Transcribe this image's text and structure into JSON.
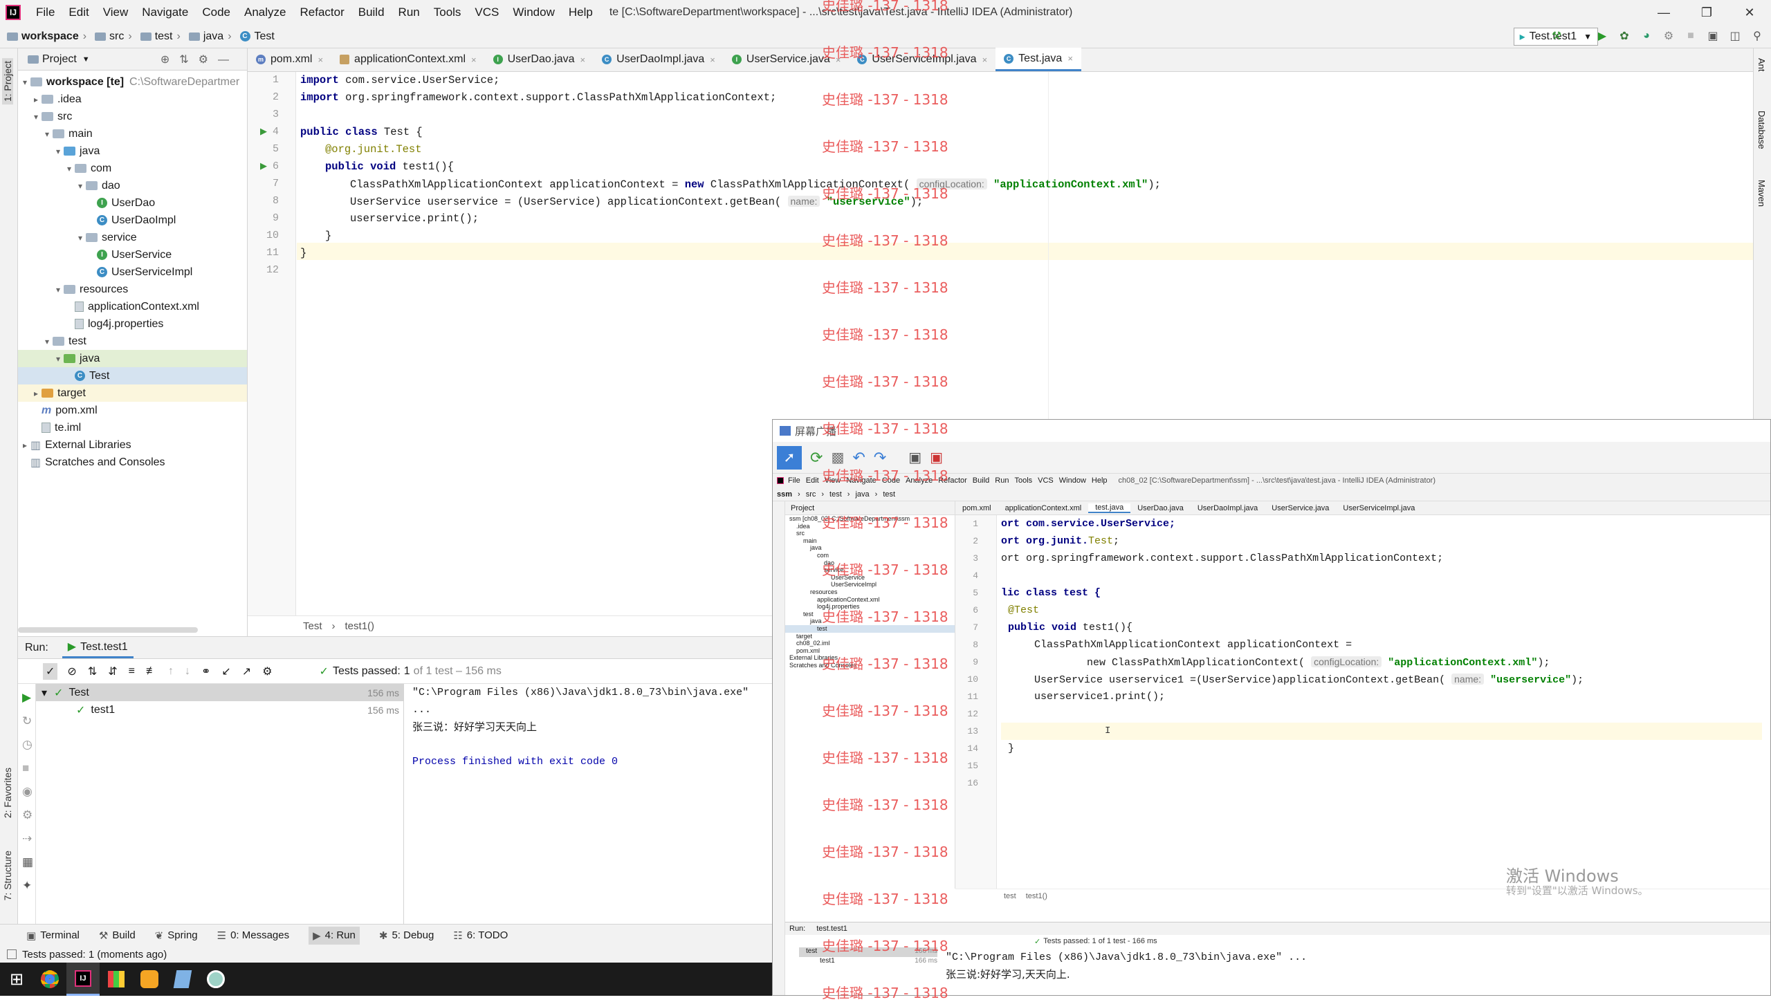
{
  "titlebar": {
    "menu": [
      "File",
      "Edit",
      "View",
      "Navigate",
      "Code",
      "Analyze",
      "Refactor",
      "Build",
      "Run",
      "Tools",
      "VCS",
      "Window",
      "Help"
    ],
    "title": "te [C:\\SoftwareDepartment\\workspace] - ...\\src\\test\\java\\Test.java - IntelliJ IDEA (Administrator)"
  },
  "nav": {
    "crumbs": [
      "workspace",
      "src",
      "test",
      "java",
      "Test"
    ],
    "run_config": "Test.test1"
  },
  "project": {
    "header": "Project",
    "side_label": "1: Project",
    "tree": [
      {
        "label": "workspace [te]",
        "extra": "C:\\SoftwareDepartmer",
        "indent": 0,
        "arrow": "v",
        "type": "folder"
      },
      {
        "label": ".idea",
        "indent": 1,
        "arrow": ">",
        "type": "folder"
      },
      {
        "label": "src",
        "indent": 1,
        "arrow": "v",
        "type": "folder"
      },
      {
        "label": "main",
        "indent": 2,
        "arrow": "v",
        "type": "folder"
      },
      {
        "label": "java",
        "indent": 3,
        "arrow": "v",
        "type": "src"
      },
      {
        "label": "com",
        "indent": 4,
        "arrow": "v",
        "type": "folder"
      },
      {
        "label": "dao",
        "indent": 5,
        "arrow": "v",
        "type": "folder"
      },
      {
        "label": "UserDao",
        "indent": 6,
        "arrow": "",
        "type": "interface"
      },
      {
        "label": "UserDaoImpl",
        "indent": 6,
        "arrow": "",
        "type": "class"
      },
      {
        "label": "service",
        "indent": 5,
        "arrow": "v",
        "type": "folder"
      },
      {
        "label": "UserService",
        "indent": 6,
        "arrow": "",
        "type": "interface"
      },
      {
        "label": "UserServiceImpl",
        "indent": 6,
        "arrow": "",
        "type": "class"
      },
      {
        "label": "resources",
        "indent": 3,
        "arrow": "v",
        "type": "folder"
      },
      {
        "label": "applicationContext.xml",
        "indent": 4,
        "arrow": "",
        "type": "file"
      },
      {
        "label": "log4j.properties",
        "indent": 4,
        "arrow": "",
        "type": "file"
      },
      {
        "label": "test",
        "indent": 2,
        "arrow": "v",
        "type": "folder"
      },
      {
        "label": "java",
        "indent": 3,
        "arrow": "v",
        "type": "test"
      },
      {
        "label": "Test",
        "indent": 4,
        "arrow": "",
        "type": "class"
      },
      {
        "label": "target",
        "indent": 1,
        "arrow": ">",
        "type": "target"
      },
      {
        "label": "pom.xml",
        "indent": 1,
        "arrow": "",
        "type": "maven"
      },
      {
        "label": "te.iml",
        "indent": 1,
        "arrow": "",
        "type": "file"
      },
      {
        "label": "External Libraries",
        "indent": 0,
        "arrow": ">",
        "type": "lib"
      },
      {
        "label": "Scratches and Consoles",
        "indent": 0,
        "arrow": "",
        "type": "lib"
      }
    ]
  },
  "tabs": [
    {
      "label": "pom.xml",
      "type": "maven"
    },
    {
      "label": "applicationContext.xml",
      "type": "file"
    },
    {
      "label": "UserDao.java",
      "type": "interface"
    },
    {
      "label": "UserDaoImpl.java",
      "type": "class"
    },
    {
      "label": "UserService.java",
      "type": "interface"
    },
    {
      "label": "UserServiceImpl.java",
      "type": "class"
    },
    {
      "label": "Test.java",
      "type": "class"
    }
  ],
  "code": {
    "line_numbers": [
      "1",
      "2",
      "3",
      "4",
      "5",
      "6",
      "7",
      "8",
      "9",
      "10",
      "11",
      "12"
    ],
    "l1a": "import ",
    "l1b": "com.service.UserService;",
    "l2a": "import ",
    "l2b": "org.springframework.context.support.ClassPathXmlApplicationContext;",
    "l4a": "public class ",
    "l4b": "Test {",
    "l5a": "@org.junit.",
    "l5b": "Test",
    "l6a": "public void ",
    "l6b": "test1(){",
    "l7a": "ClassPathXmlApplicationContext applicationContext = ",
    "l7b": "new ",
    "l7c": "ClassPathXmlApplicationContext(",
    "l7hint": "configLocation:",
    "l7str": "\"applicationContext.xml\"",
    "l7e": ");",
    "l8a": "UserService userservice = (UserService) applicationContext.getBean(",
    "l8hint": "name:",
    "l8str": "\"userservice\"",
    "l8e": ");",
    "l9": "userservice.print();",
    "l10": "}",
    "l11": "}",
    "footer": [
      "Test",
      "test1()"
    ]
  },
  "run": {
    "label": "Run:",
    "tab": "Test.test1",
    "passed": "Tests passed:",
    "passed_count": "1",
    "passed_rest": "of 1 test – 156 ms",
    "tree": [
      {
        "label": "Test",
        "time": "156 ms"
      },
      {
        "label": "test1",
        "time": "156 ms"
      }
    ],
    "console": [
      "\"C:\\Program Files (x86)\\Java\\jdk1.8.0_73\\bin\\java.exe\" ...",
      "张三说：好好学习天天向上",
      "",
      "Process finished with exit code 0"
    ]
  },
  "side_labels": {
    "favorites": "2: Favorites",
    "structure": "7: Structure",
    "ant": "Ant",
    "database": "Database",
    "maven": "Maven"
  },
  "bottom_tools": [
    {
      "label": "Terminal"
    },
    {
      "label": "Build"
    },
    {
      "label": "Spring"
    },
    {
      "label": "0: Messages"
    },
    {
      "label": "4: Run"
    },
    {
      "label": "5: Debug"
    },
    {
      "label": "6: TODO"
    }
  ],
  "status": "Tests passed: 1 (moments ago)",
  "watermark": "史佳璐 -137 - 1318",
  "overlay": {
    "window_title": "屏幕广播",
    "menu": [
      "File",
      "Edit",
      "View",
      "Navigate",
      "Code",
      "Analyze",
      "Refactor",
      "Build",
      "Run",
      "Tools",
      "VCS",
      "Window",
      "Help"
    ],
    "title": "ch08_02 [C:\\SoftwareDepartment\\ssm] - ...\\src\\test\\java\\test.java - IntelliJ IDEA (Administrator)",
    "crumbs": [
      "ssm",
      "src",
      "test",
      "java",
      "test"
    ],
    "tabs": [
      "pom.xml",
      "applicationContext.xml",
      "test.java",
      "UserDao.java",
      "UserDaoImpl.java",
      "UserService.java",
      "UserServiceImpl.java"
    ],
    "project_header": "Project",
    "tree": [
      "ssm [ch08_02]  C:\\SoftwareDepartment\\ssm",
      ".idea",
      "src",
      "main",
      "java",
      "com",
      "dao",
      "service",
      "UserService",
      "UserServiceImpl",
      "resources",
      "applicationContext.xml",
      "log4j.properties",
      "test",
      "java",
      "test",
      "target",
      "ch08_02.iml",
      "pom.xml",
      "External Libraries",
      "Scratches and Consoles"
    ],
    "line_numbers": [
      "1",
      "2",
      "3",
      "4",
      "5",
      "6",
      "7",
      "8",
      "9",
      "10",
      "11",
      "12",
      "13",
      "14",
      "15",
      "16"
    ],
    "c1": "ort com.service.UserService;",
    "c2a": "ort org.junit.",
    "c2b": "Test",
    "c3": "ort org.springframework.context.support.ClassPathXmlApplicationContext;",
    "c5": "lic class test {",
    "c6": "@Test",
    "c7a": "public void ",
    "c7b": "test1(){",
    "c8": "ClassPathXmlApplicationContext applicationContext =",
    "c9a": "new ClassPathXmlApplicationContext(",
    "c9hint": "configLocation:",
    "c9str": "\"applicationContext.xml\"",
    "c9e": ");",
    "c10a": "UserService userservice1 =(UserService)applicationContext.getBean(",
    "c10hint": "name:",
    "c10str": "\"userservice\"",
    "c10e": ");",
    "c11": "userservice1.print();",
    "c14": "}",
    "footer": [
      "test",
      "test1()"
    ],
    "run_label": "Run:",
    "run_tab": "test.test1",
    "passed": "Tests passed: 1 of 1 test - 166 ms",
    "run_tree": [
      {
        "label": "test",
        "time": "166 ms"
      },
      {
        "label": "test1",
        "time": "166 ms"
      }
    ],
    "console1": "\"C:\\Program Files (x86)\\Java\\jdk1.8.0_73\\bin\\java.exe\" ...",
    "console2": "张三说:好好学习,天天向上.",
    "activate1": "激活 Windows",
    "activate2": "转到\"设置\"以激活 Windows。"
  }
}
